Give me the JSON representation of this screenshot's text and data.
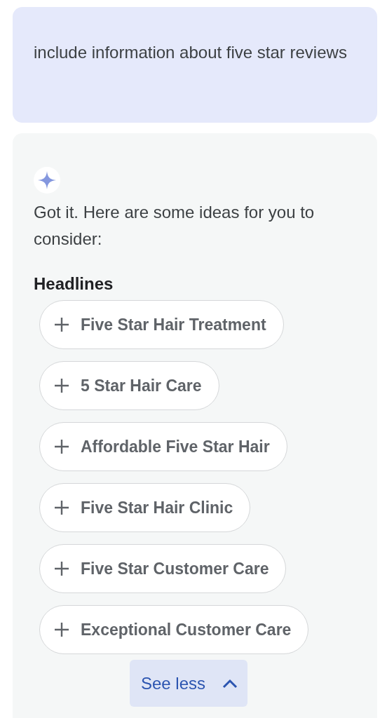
{
  "prompt": {
    "text": "include information about five star reviews"
  },
  "response": {
    "intro": "Got it. Here are some ideas for you to consider:",
    "section_title": "Headlines",
    "suggestions": [
      {
        "label": "Five Star Hair Treatment"
      },
      {
        "label": "5 Star Hair Care"
      },
      {
        "label": "Affordable Five Star Hair"
      },
      {
        "label": "Five Star Hair Clinic"
      },
      {
        "label": "Five Star Customer Care"
      },
      {
        "label": "Exceptional Customer Care"
      }
    ],
    "toggle": {
      "label": "See less",
      "expanded": true
    }
  }
}
